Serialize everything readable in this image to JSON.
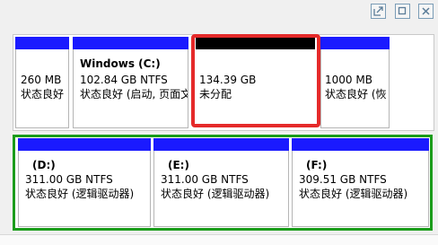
{
  "colors": {
    "primary_bar": "#1a1aff",
    "unallocated_bar": "#000000",
    "logical_border": "#1a9c1a",
    "selection": "#e52a2a"
  },
  "window_controls": [
    {
      "name": "popout-icon"
    },
    {
      "name": "restore-icon"
    },
    {
      "name": "close-icon"
    }
  ],
  "disk0": {
    "partitions": [
      {
        "title": "",
        "size": "260 MB",
        "status": "状态良好"
      },
      {
        "title": "Windows  (C:)",
        "size": "102.84 GB NTFS",
        "status": "状态良好 (启动, 页面文"
      },
      {
        "title": "",
        "size": "134.39 GB",
        "status": "未分配"
      },
      {
        "title": "",
        "size": "1000 MB",
        "status": "状态良好 (恢"
      }
    ]
  },
  "disk1": {
    "partitions": [
      {
        "title": "(D:)",
        "size": "311.00 GB NTFS",
        "status": "状态良好 (逻辑驱动器)"
      },
      {
        "title": "(E:)",
        "size": "311.00 GB NTFS",
        "status": "状态良好 (逻辑驱动器)"
      },
      {
        "title": "(F:)",
        "size": "309.51 GB NTFS",
        "status": "状态良好 (逻辑驱动器)"
      }
    ]
  }
}
